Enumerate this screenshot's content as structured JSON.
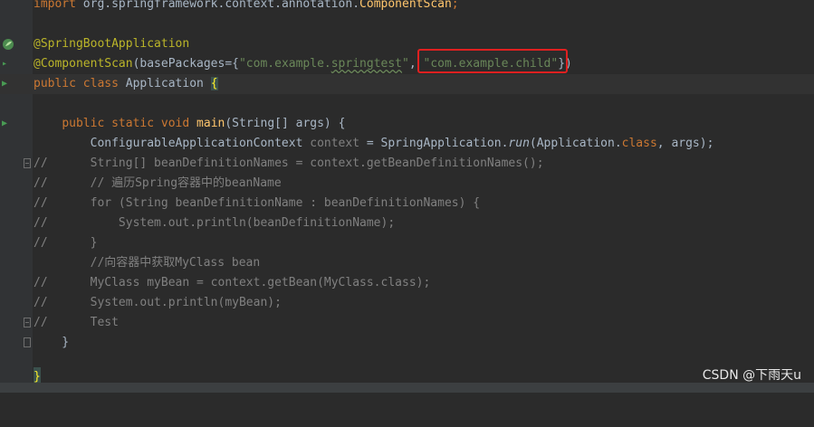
{
  "editor": {
    "import_keyword": "import",
    "import_path": " org.springframework.context.annotation.",
    "import_class": "ComponentScan",
    "import_semicolon": ";",
    "ann_spring_boot": "@SpringBootApplication",
    "ann_component_scan": "@ComponentScan",
    "base_packages_open": "(basePackages={",
    "pkg1_quote_open": "\"com.example.",
    "pkg1_squiggle": "springtest",
    "pkg1_quote_close": "\"",
    "pkg_sep": ", ",
    "pkg2": "\"com.example.child\"",
    "base_packages_close": "})",
    "public_kw": "public",
    "class_kw": "class",
    "class_name": " Application ",
    "open_brace": "{",
    "indent_main": "    ",
    "static_kw": "static",
    "void_kw": "void",
    "main_name": "main",
    "main_params": "(String[] args) {",
    "ctx_type": "        ConfigurableApplicationContext ",
    "ctx_var": "context",
    "ctx_assign": " = SpringApplication.",
    "run_method": "run",
    "run_args_open": "(Application.",
    "run_class_kw": "class",
    "run_args_close": ", args);",
    "c1_prefix": "//",
    "c1": "      String[] beanDefinitionNames = context.getBeanDefinitionNames();",
    "c2_prefix": "//",
    "c2": "      // 遍历Spring容器中的beanName",
    "c3_prefix": "//",
    "c3": "      for (String beanDefinitionName : beanDefinitionNames) {",
    "c4_prefix": "//",
    "c4": "          System.out.println(beanDefinitionName);",
    "c5_prefix": "//",
    "c5": "      }",
    "c6": "        //向容器中获取MyClass bean",
    "c7_prefix": "//",
    "c7": "      MyClass myBean = context.getBean(MyClass.class);",
    "c8_prefix": "//",
    "c8": "      System.out.println(myBean);",
    "c9_prefix": "//",
    "c9": "      Test",
    "close_main": "    }",
    "close_class": "}"
  },
  "watermark": "CSDN @下雨天u",
  "colors": {
    "background": "#2b2b2b",
    "keyword": "#cc7832",
    "annotation": "#bbb529",
    "string": "#6a8759",
    "comment": "#808080",
    "method": "#ffc66d",
    "highlight_box": "#e02020"
  }
}
